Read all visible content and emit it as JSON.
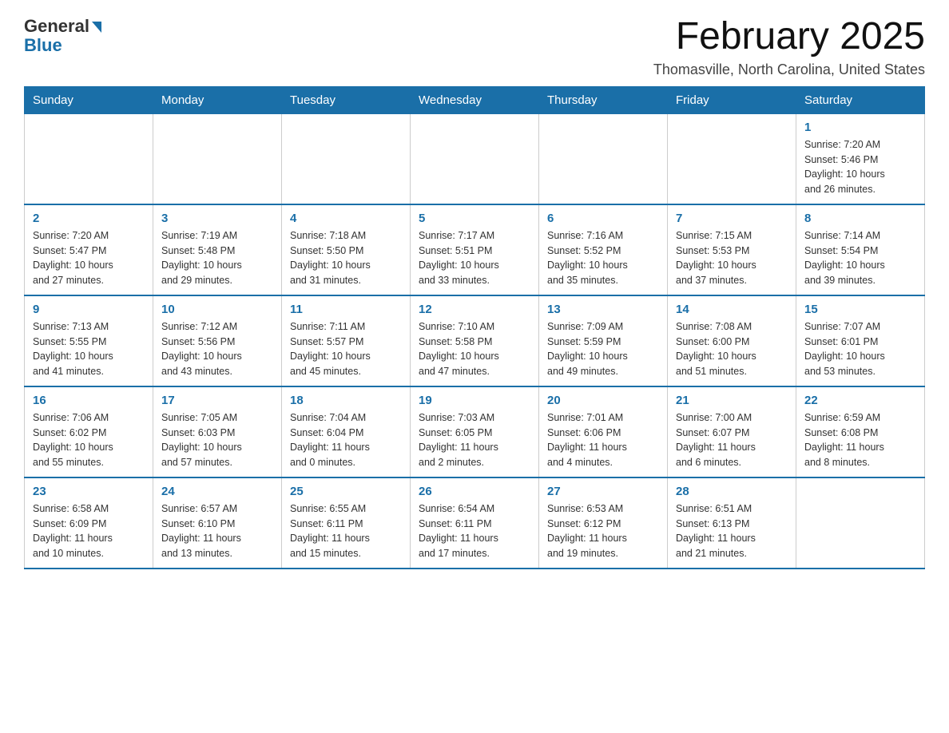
{
  "logo": {
    "general": "General",
    "blue": "Blue"
  },
  "title": "February 2025",
  "subtitle": "Thomasville, North Carolina, United States",
  "weekdays": [
    "Sunday",
    "Monday",
    "Tuesday",
    "Wednesday",
    "Thursday",
    "Friday",
    "Saturday"
  ],
  "weeks": [
    [
      {
        "day": "",
        "info": ""
      },
      {
        "day": "",
        "info": ""
      },
      {
        "day": "",
        "info": ""
      },
      {
        "day": "",
        "info": ""
      },
      {
        "day": "",
        "info": ""
      },
      {
        "day": "",
        "info": ""
      },
      {
        "day": "1",
        "info": "Sunrise: 7:20 AM\nSunset: 5:46 PM\nDaylight: 10 hours\nand 26 minutes."
      }
    ],
    [
      {
        "day": "2",
        "info": "Sunrise: 7:20 AM\nSunset: 5:47 PM\nDaylight: 10 hours\nand 27 minutes."
      },
      {
        "day": "3",
        "info": "Sunrise: 7:19 AM\nSunset: 5:48 PM\nDaylight: 10 hours\nand 29 minutes."
      },
      {
        "day": "4",
        "info": "Sunrise: 7:18 AM\nSunset: 5:50 PM\nDaylight: 10 hours\nand 31 minutes."
      },
      {
        "day": "5",
        "info": "Sunrise: 7:17 AM\nSunset: 5:51 PM\nDaylight: 10 hours\nand 33 minutes."
      },
      {
        "day": "6",
        "info": "Sunrise: 7:16 AM\nSunset: 5:52 PM\nDaylight: 10 hours\nand 35 minutes."
      },
      {
        "day": "7",
        "info": "Sunrise: 7:15 AM\nSunset: 5:53 PM\nDaylight: 10 hours\nand 37 minutes."
      },
      {
        "day": "8",
        "info": "Sunrise: 7:14 AM\nSunset: 5:54 PM\nDaylight: 10 hours\nand 39 minutes."
      }
    ],
    [
      {
        "day": "9",
        "info": "Sunrise: 7:13 AM\nSunset: 5:55 PM\nDaylight: 10 hours\nand 41 minutes."
      },
      {
        "day": "10",
        "info": "Sunrise: 7:12 AM\nSunset: 5:56 PM\nDaylight: 10 hours\nand 43 minutes."
      },
      {
        "day": "11",
        "info": "Sunrise: 7:11 AM\nSunset: 5:57 PM\nDaylight: 10 hours\nand 45 minutes."
      },
      {
        "day": "12",
        "info": "Sunrise: 7:10 AM\nSunset: 5:58 PM\nDaylight: 10 hours\nand 47 minutes."
      },
      {
        "day": "13",
        "info": "Sunrise: 7:09 AM\nSunset: 5:59 PM\nDaylight: 10 hours\nand 49 minutes."
      },
      {
        "day": "14",
        "info": "Sunrise: 7:08 AM\nSunset: 6:00 PM\nDaylight: 10 hours\nand 51 minutes."
      },
      {
        "day": "15",
        "info": "Sunrise: 7:07 AM\nSunset: 6:01 PM\nDaylight: 10 hours\nand 53 minutes."
      }
    ],
    [
      {
        "day": "16",
        "info": "Sunrise: 7:06 AM\nSunset: 6:02 PM\nDaylight: 10 hours\nand 55 minutes."
      },
      {
        "day": "17",
        "info": "Sunrise: 7:05 AM\nSunset: 6:03 PM\nDaylight: 10 hours\nand 57 minutes."
      },
      {
        "day": "18",
        "info": "Sunrise: 7:04 AM\nSunset: 6:04 PM\nDaylight: 11 hours\nand 0 minutes."
      },
      {
        "day": "19",
        "info": "Sunrise: 7:03 AM\nSunset: 6:05 PM\nDaylight: 11 hours\nand 2 minutes."
      },
      {
        "day": "20",
        "info": "Sunrise: 7:01 AM\nSunset: 6:06 PM\nDaylight: 11 hours\nand 4 minutes."
      },
      {
        "day": "21",
        "info": "Sunrise: 7:00 AM\nSunset: 6:07 PM\nDaylight: 11 hours\nand 6 minutes."
      },
      {
        "day": "22",
        "info": "Sunrise: 6:59 AM\nSunset: 6:08 PM\nDaylight: 11 hours\nand 8 minutes."
      }
    ],
    [
      {
        "day": "23",
        "info": "Sunrise: 6:58 AM\nSunset: 6:09 PM\nDaylight: 11 hours\nand 10 minutes."
      },
      {
        "day": "24",
        "info": "Sunrise: 6:57 AM\nSunset: 6:10 PM\nDaylight: 11 hours\nand 13 minutes."
      },
      {
        "day": "25",
        "info": "Sunrise: 6:55 AM\nSunset: 6:11 PM\nDaylight: 11 hours\nand 15 minutes."
      },
      {
        "day": "26",
        "info": "Sunrise: 6:54 AM\nSunset: 6:11 PM\nDaylight: 11 hours\nand 17 minutes."
      },
      {
        "day": "27",
        "info": "Sunrise: 6:53 AM\nSunset: 6:12 PM\nDaylight: 11 hours\nand 19 minutes."
      },
      {
        "day": "28",
        "info": "Sunrise: 6:51 AM\nSunset: 6:13 PM\nDaylight: 11 hours\nand 21 minutes."
      },
      {
        "day": "",
        "info": ""
      }
    ]
  ]
}
